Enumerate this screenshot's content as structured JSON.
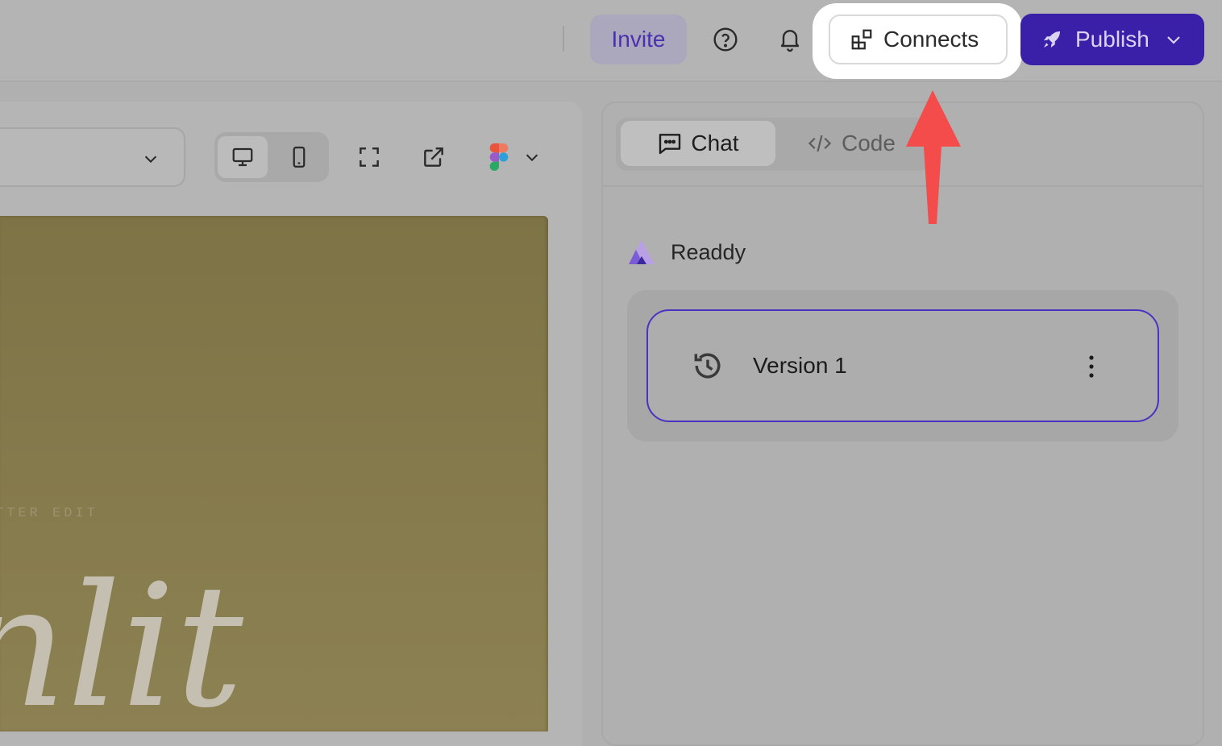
{
  "topbar": {
    "invite_label": "Invite",
    "help_icon": "question-circle-icon",
    "notifications_icon": "bell-icon",
    "connects_label": "Connects",
    "connects_icon": "apps-grid-icon",
    "publish_label": "Publish",
    "publish_icon": "rocket-icon"
  },
  "toolbar": {
    "device_options": [
      "desktop",
      "mobile"
    ],
    "active_device": "desktop",
    "tools": [
      "fullscreen-icon",
      "open-external-icon",
      "figma-icon"
    ]
  },
  "canvas": {
    "caption": "TTER EDIT",
    "headline": "nlit"
  },
  "chat_panel": {
    "tabs": [
      {
        "label": "Chat",
        "icon": "chat-icon",
        "active": true
      },
      {
        "label": "Code",
        "icon": "code-icon",
        "active": false
      }
    ],
    "author": "Readdy",
    "version": {
      "label": "Version 1",
      "icon": "history-icon"
    }
  },
  "colors": {
    "accent": "#3a1fa8",
    "version_border": "#4b33c2",
    "annotation_arrow": "#f44b4b"
  }
}
